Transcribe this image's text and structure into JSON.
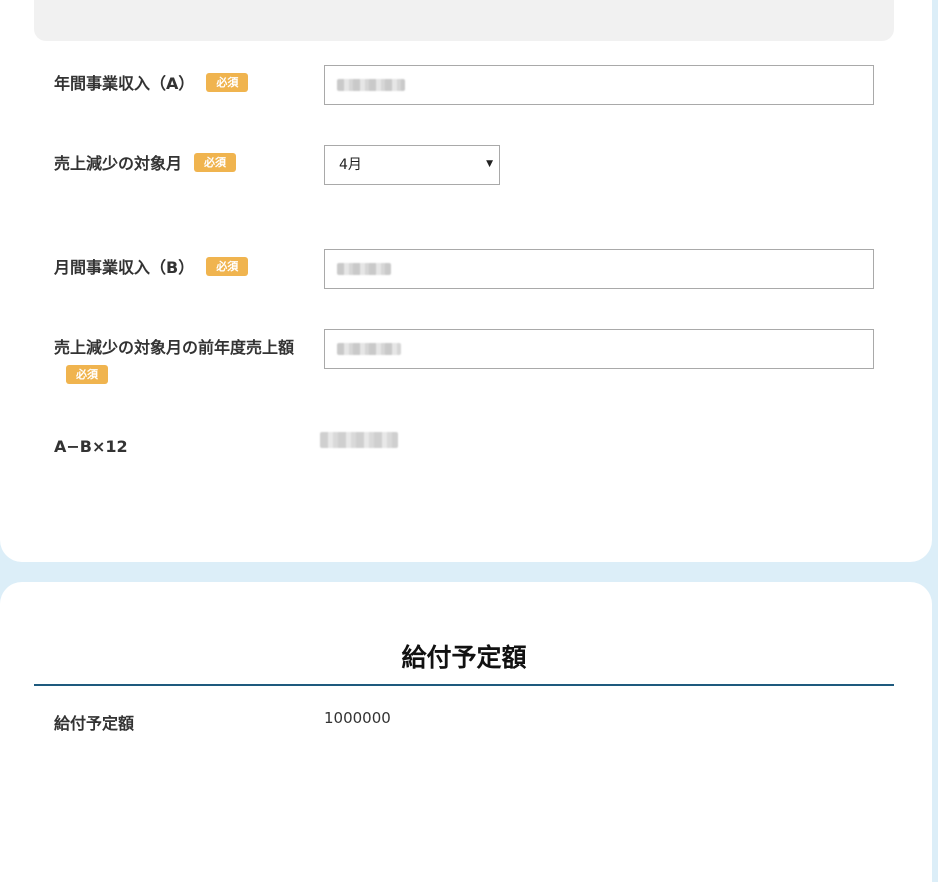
{
  "form": {
    "required_badge": "必須",
    "annual_income": {
      "label": "年間事業収入（A）",
      "value": ""
    },
    "target_month": {
      "label": "売上減少の対象月",
      "selected": "4月"
    },
    "monthly_income": {
      "label": "月間事業収入（B）",
      "value": ""
    },
    "prev_year_sales": {
      "label": "売上減少の対象月の前年度売上額",
      "value": ""
    },
    "calc": {
      "label": "A−B×12"
    }
  },
  "benefit": {
    "title": "給付予定額",
    "label": "給付予定額",
    "value": "1000000"
  },
  "colors": {
    "badge": "#f0b44f",
    "accent_line": "#1e5a7e",
    "background": "#dceef8"
  }
}
